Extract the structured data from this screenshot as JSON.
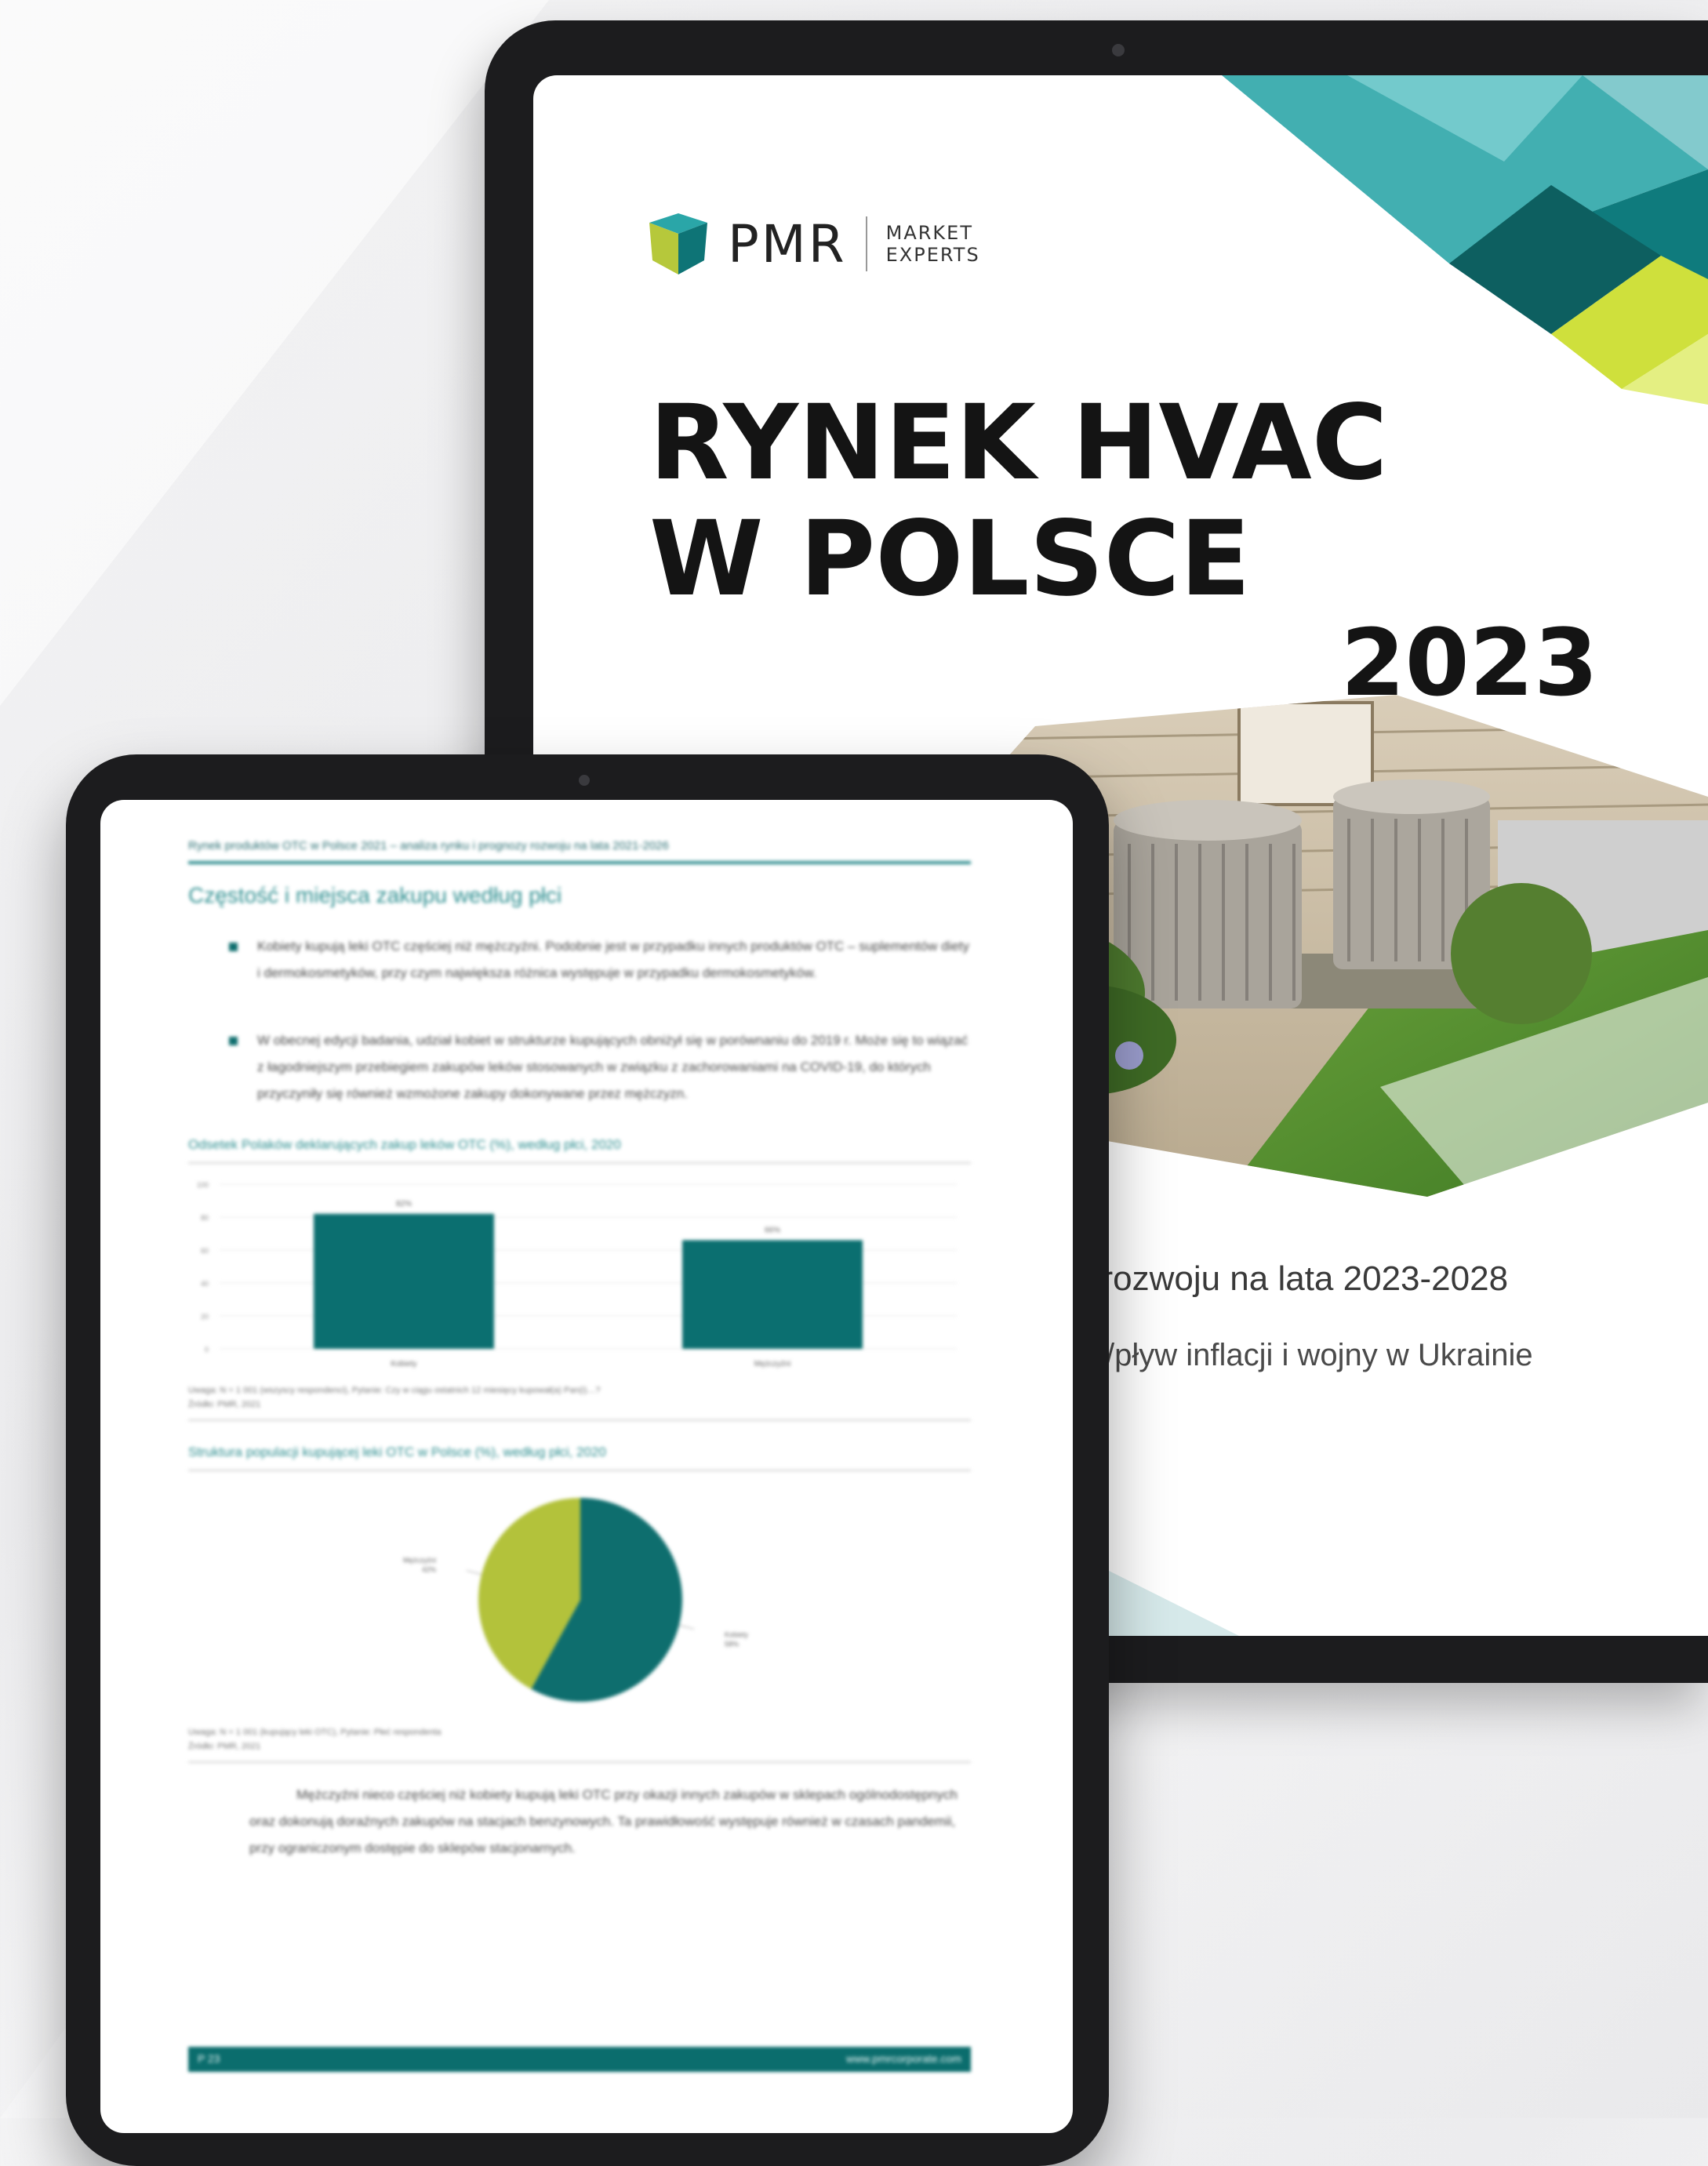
{
  "cover": {
    "logo_text": "PMR",
    "logo_sub_1": "MARKET",
    "logo_sub_2": "EXPERTS",
    "title_line1": "RYNEK HVAC",
    "title_line2": "W POLSCE",
    "year": "2023",
    "subtitle1": "/ rozwoju na lata 2023-2028",
    "subtitle2": "/pływ inflacji i wojny w Ukrainie"
  },
  "report_page": {
    "header": "Rynek produktów OTC w Polsce 2021 – analiza rynku i prognozy rozwoju na lata 2021-2026",
    "section_title": "Częstość i miejsca zakupu według płci",
    "bullets": [
      "Kobiety kupują leki OTC częściej niż mężczyźni. Podobnie jest w przypadku innych produktów OTC – suplementów diety i dermokosmetyków, przy czym największa różnica występuje w przypadku dermokosmetyków.",
      "W obecnej edycji badania, udział kobiet w strukturze kupujących obniżył się w porównaniu do 2019 r. Może się to wiązać z łagodniejszym przebiegiem zakupów leków stosowanych w związku z zachorowaniami na COVID-19, do których przyczyniły się również wzmożone zakupy dokonywane przez mężczyzn."
    ],
    "bar_chart_title": "Odsetek Polaków deklarujących zakup leków OTC (%), według płci, 2020",
    "bar_source_1": "Uwaga: N = 1 001 (wszyscy respondenci), Pytanie: Czy w ciągu ostatnich 12 miesięcy kupował(a) Pan(i)…?",
    "bar_source_2": "Źródło: PMR, 2021",
    "pie_chart_title": "Struktura populacji kupującej leki OTC w Polsce (%), według płci, 2020",
    "pie_source_1": "Uwaga: N = 1 001 (kupujący leki OTC), Pytanie: Płeć respondenta",
    "pie_source_2": "Źródło: PMR, 2021",
    "closing_paragraph": "Mężczyźni nieco częściej niż kobiety kupują leki OTC przy okazji innych zakupów w sklepach ogólnodostępnych oraz dokonują doraźnych zakupów na stacjach benzynowych. Ta prawidłowość występuje również w czasach pandemii, przy ograniczonym dostępie do sklepów stacjonarnych.",
    "footer_page": "P 23",
    "footer_url": "www.pmrcorporate.com"
  },
  "chart_data": [
    {
      "type": "bar",
      "categories": [
        "Kobiety",
        "Mężczyźni"
      ],
      "values": [
        82,
        66
      ],
      "value_labels": [
        "82%",
        "66%"
      ],
      "yticks": [
        "100",
        "80",
        "60",
        "40",
        "20",
        "0"
      ],
      "ylim": [
        0,
        100
      ],
      "colors": [
        "#0b6f70",
        "#0b6f70"
      ]
    },
    {
      "type": "pie",
      "labels": [
        "Kobiety",
        "Mężczyźni"
      ],
      "value_labels": [
        "58%",
        "42%"
      ],
      "values": [
        58,
        42
      ],
      "colors": [
        "#0e6e6e",
        "#b3c23b"
      ]
    }
  ],
  "colors": {
    "teal": "#0b6f70",
    "lime": "#b3c23b",
    "aqua": "#4fb7ba"
  }
}
